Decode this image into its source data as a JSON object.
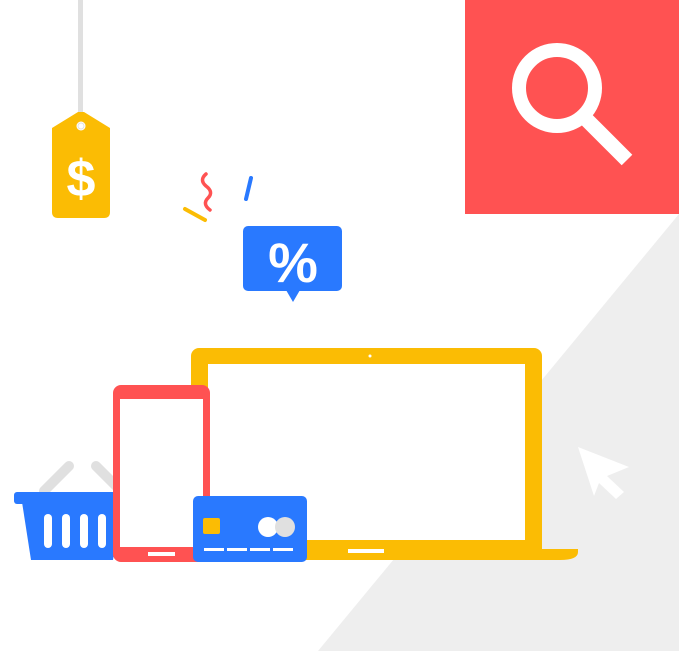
{
  "price_tag": {
    "symbol": "$"
  },
  "discount_bubble": {
    "symbol": "%"
  },
  "colors": {
    "background": "#FFFFFF",
    "shadow": "#EEEEEE",
    "red": "#FF5252",
    "yellow": "#FBBC04",
    "blue": "#2979FF",
    "light_gray": "#E0E0E0",
    "white": "#FFFFFF"
  },
  "icons": [
    "price-tag-icon",
    "discount-bubble-icon",
    "search-icon",
    "confetti-icon",
    "laptop-icon",
    "phone-icon",
    "credit-card-icon",
    "shopping-basket-icon",
    "cursor-icon"
  ]
}
